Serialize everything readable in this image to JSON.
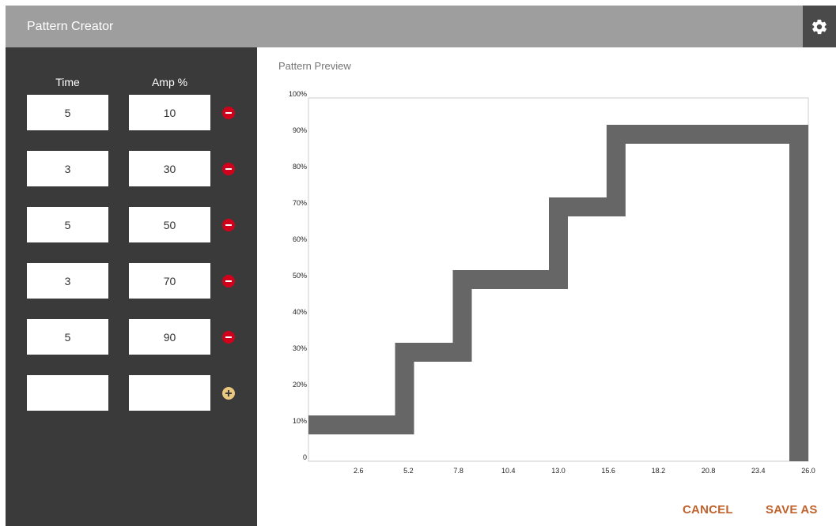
{
  "header": {
    "title": "Pattern Creator",
    "settings_icon": "gear-icon"
  },
  "sidebar": {
    "time_header": "Time",
    "amp_header": "Amp %",
    "rows": [
      {
        "time": "5",
        "amp": "10"
      },
      {
        "time": "3",
        "amp": "30"
      },
      {
        "time": "5",
        "amp": "50"
      },
      {
        "time": "3",
        "amp": "70"
      },
      {
        "time": "5",
        "amp": "90"
      }
    ],
    "new_row": {
      "time": "",
      "amp": ""
    },
    "remove_icon": "minus-circle-icon",
    "add_icon": "plus-circle-icon",
    "colors": {
      "remove": "#d0021b",
      "add": "#e8c77e",
      "panel": "#3b3a3b"
    }
  },
  "preview": {
    "label": "Pattern Preview"
  },
  "chart_data": {
    "type": "line",
    "title": "",
    "xlabel": "",
    "ylabel": "",
    "x_ticks": [
      "2.6",
      "5.2",
      "7.8",
      "10.4",
      "13.0",
      "15.6",
      "18.2",
      "20.8",
      "23.4",
      "26.0"
    ],
    "y_ticks": [
      "0",
      "10%",
      "20%",
      "30%",
      "40%",
      "50%",
      "60%",
      "70%",
      "80%",
      "90%",
      "100%"
    ],
    "xlim": [
      0,
      26
    ],
    "ylim": [
      0,
      100
    ],
    "grid": false,
    "series": [
      {
        "x": [
          0,
          5,
          5,
          8,
          8,
          13,
          13,
          16,
          16,
          21,
          21,
          26,
          26
        ],
        "y": [
          10,
          10,
          30,
          30,
          50,
          50,
          70,
          70,
          90,
          90,
          90,
          90,
          0
        ],
        "color": "#666666"
      }
    ]
  },
  "actions": {
    "cancel": "CANCEL",
    "save_as": "SAVE AS",
    "color": "#c0622c"
  }
}
